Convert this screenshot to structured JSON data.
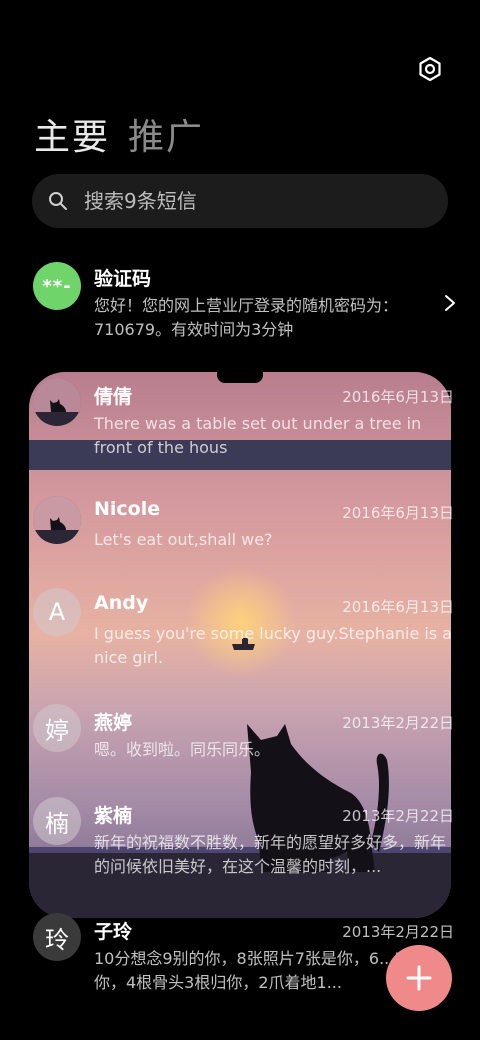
{
  "header": {
    "settings_icon": "gear-icon"
  },
  "tabs": [
    {
      "label": "主要",
      "active": true
    },
    {
      "label": "推广",
      "active": false
    }
  ],
  "search": {
    "placeholder": "搜索9条短信",
    "icon": "search-icon"
  },
  "pinned": {
    "avatar_text": "**-",
    "avatar_color": "#6fd46a",
    "name": "验证码",
    "snippet": "您好！您的网上营业厅登录的随机密码为：710679。有效时间为3分钟"
  },
  "conversations": [
    {
      "name": "倩倩",
      "date": "2016年6月13日",
      "snippet": "There was a table set out under a tree in front of the hous",
      "avatar": "cat-photo"
    },
    {
      "name": "Nicole",
      "date": "2016年6月13日",
      "snippet": "Let's eat out,shall we?",
      "avatar": "cat-photo"
    },
    {
      "name": "Andy",
      "date": "2016年6月13日",
      "snippet": "I guess you're some lucky guy.Stephanie is a nice girl.",
      "avatar_text": "A"
    },
    {
      "name": "燕婷",
      "date": "2013年2月22日",
      "snippet": "嗯。收到啦。同乐同乐。",
      "avatar_text": "婷"
    },
    {
      "name": "紫楠",
      "date": "2013年2月22日",
      "snippet": "新年的祝福数不胜数，新年的愿望好多好多，新年的问候依旧美好，在这个温馨的时刻，...",
      "avatar_text": "楠"
    },
    {
      "name": "子玲",
      "date": "2013年2月22日",
      "snippet": "10分想念9别的你，8张照片7张是你，6...5只像你，4根骨头3根归你，2爪着地1...",
      "avatar_text": "玲"
    }
  ],
  "fab": {
    "icon": "plus-icon",
    "color": "#f08a8a"
  }
}
